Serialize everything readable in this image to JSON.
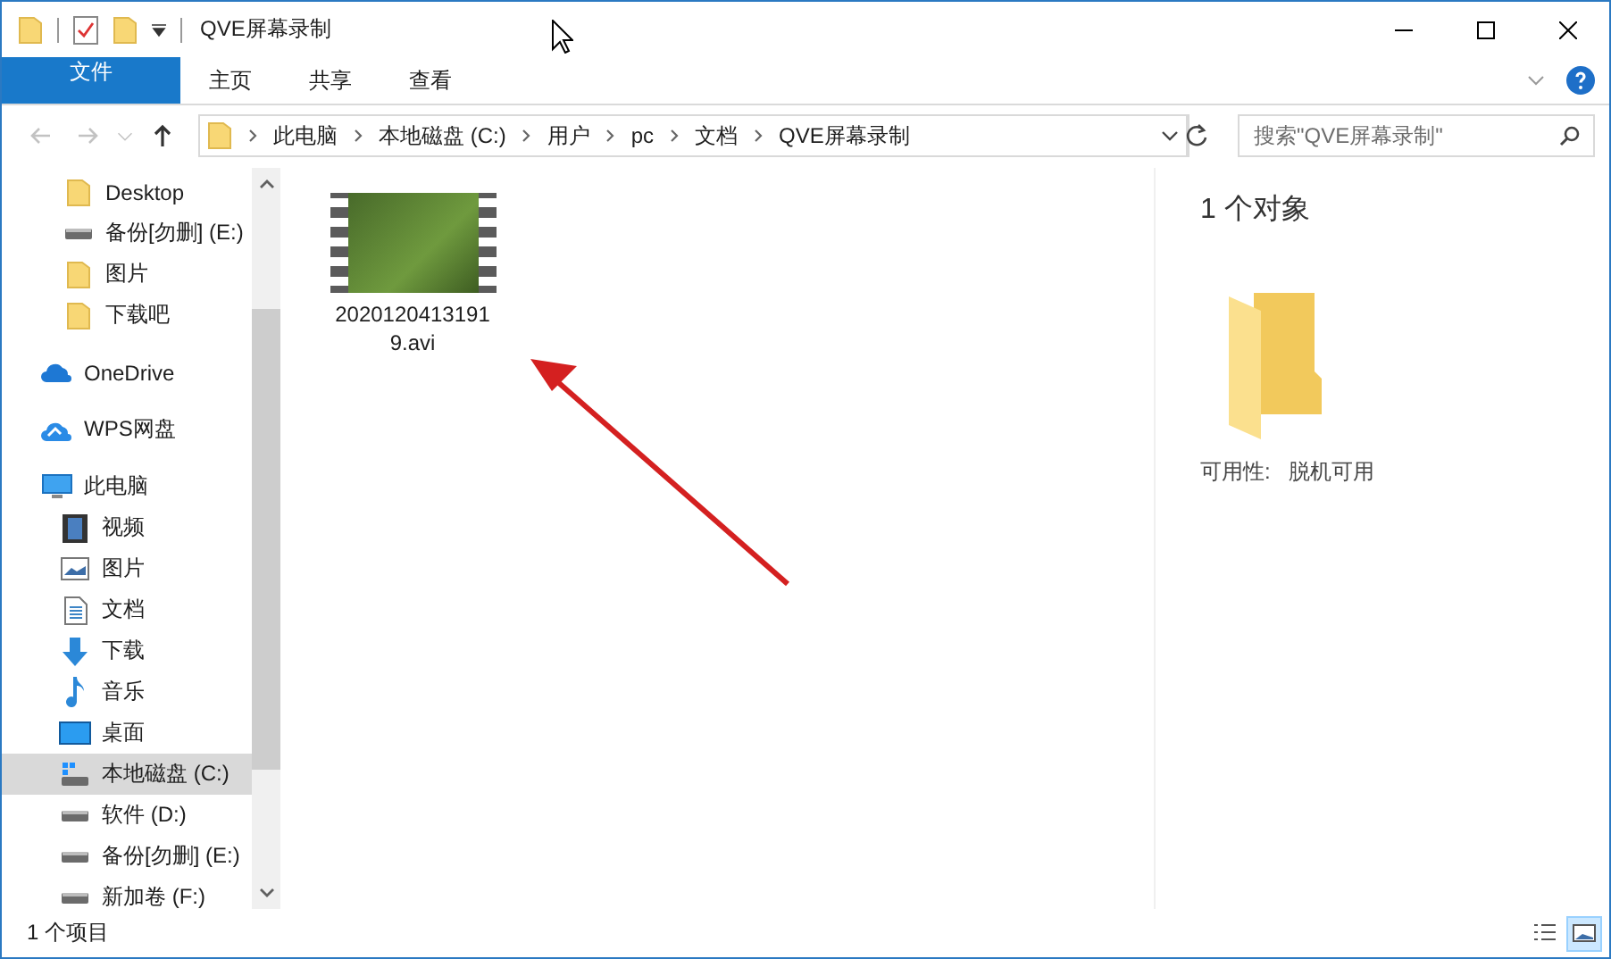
{
  "window": {
    "title": "QVE屏幕录制"
  },
  "ribbon": {
    "tabs": [
      {
        "label": "文件",
        "kind": "file"
      },
      {
        "label": "主页",
        "kind": "tab"
      },
      {
        "label": "共享",
        "kind": "tab"
      },
      {
        "label": "查看",
        "kind": "tab"
      }
    ]
  },
  "navigation": {
    "buttons": [
      {
        "kind": "back",
        "disabled": true
      },
      {
        "kind": "forward",
        "disabled": true
      },
      {
        "kind": "recent",
        "disabled": true
      },
      {
        "kind": "up",
        "disabled": false
      }
    ],
    "address_bar": {
      "crumbs": [
        "此电脑",
        "本地磁盘 (C:)",
        "用户",
        "pc",
        "文档",
        "QVE屏幕录制"
      ]
    },
    "search": {
      "placeholder": "搜索\"QVE屏幕录制\""
    }
  },
  "sidebar": {
    "quick_access": [
      {
        "label": "Desktop",
        "kind": "folder",
        "selected": false
      },
      {
        "label": "备份[勿删] (E:)",
        "kind": "drive",
        "selected": false
      },
      {
        "label": "图片",
        "kind": "folder",
        "selected": false
      },
      {
        "label": "下载吧",
        "kind": "folder",
        "selected": false
      }
    ],
    "roots": [
      {
        "label": "OneDrive",
        "kind": "onedrive",
        "selected": false
      },
      {
        "label": "WPS网盘",
        "kind": "wps",
        "selected": false
      },
      {
        "label": "此电脑",
        "kind": "pc",
        "selected": false,
        "children": [
          {
            "label": "视频",
            "kind": "video",
            "selected": false
          },
          {
            "label": "图片",
            "kind": "pictures",
            "selected": false
          },
          {
            "label": "文档",
            "kind": "documents",
            "selected": false
          },
          {
            "label": "下载",
            "kind": "downloads",
            "selected": false
          },
          {
            "label": "音乐",
            "kind": "music",
            "selected": false
          },
          {
            "label": "桌面",
            "kind": "desktop",
            "selected": false
          },
          {
            "label": "本地磁盘 (C:)",
            "kind": "sysdrive",
            "selected": true
          },
          {
            "label": "软件 (D:)",
            "kind": "drive",
            "selected": false
          },
          {
            "label": "备份[勿删] (E:)",
            "kind": "drive",
            "selected": false
          },
          {
            "label": "新加卷 (F:)",
            "kind": "drive",
            "selected": false
          }
        ]
      }
    ]
  },
  "content": {
    "files": [
      {
        "name": "20201204131919.avi",
        "kind": "video",
        "selected": false
      }
    ]
  },
  "details_pane": {
    "summary": "1 个对象",
    "properties": [
      {
        "label": "可用性:",
        "value": "脱机可用"
      }
    ]
  },
  "status_bar": {
    "item_count": "1 个项目",
    "views": [
      {
        "kind": "details",
        "selected": false
      },
      {
        "kind": "large_icons",
        "selected": true
      }
    ]
  }
}
